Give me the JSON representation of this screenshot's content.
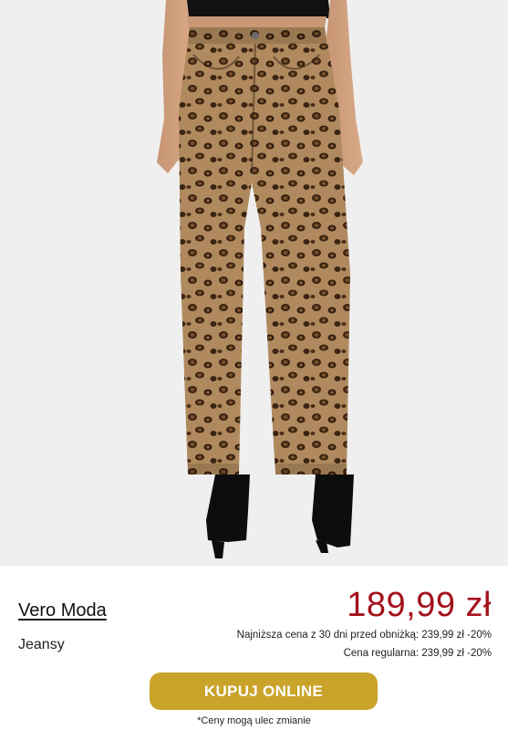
{
  "product": {
    "brand": "Vero Moda",
    "category": "Jeansy",
    "price": "189,99 zł",
    "lowest_price_note": "Najniższa cena z 30 dni przed obniżką: 239,99 zł -20%",
    "regular_price_note": "Cena regularna: 239,99 zł -20%",
    "buy_label": "KUPUJ ONLINE",
    "disclaimer": "*Ceny mogą ulec zmianie"
  },
  "colors": {
    "price": "#a3121c",
    "button": "#c9a32a",
    "image_background": "#efefef"
  }
}
